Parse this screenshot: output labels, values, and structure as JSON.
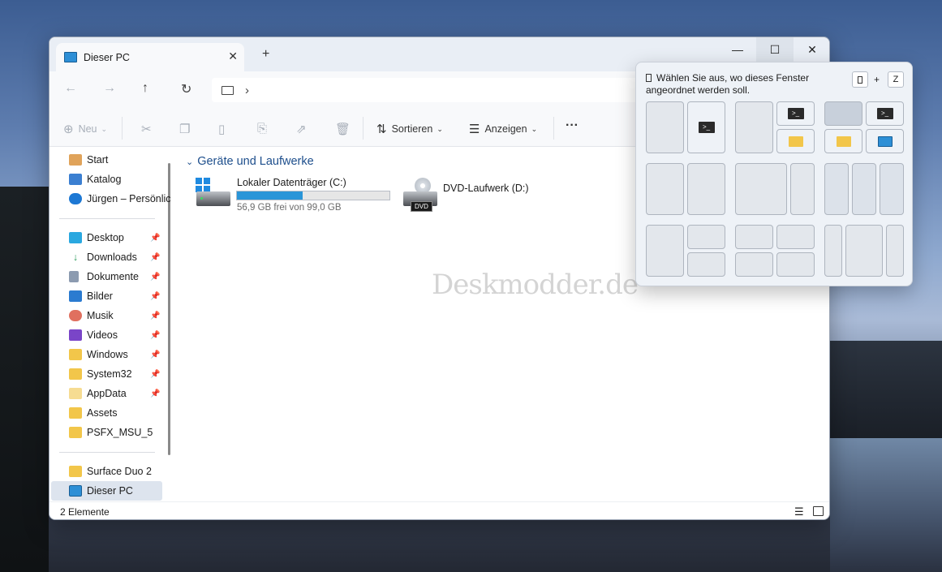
{
  "window": {
    "tab_title": "Dieser PC",
    "tab_close": "✕",
    "new_tab": "+",
    "minimize": "—",
    "maximize": "☐",
    "close": "✕"
  },
  "nav": {
    "back": "←",
    "forward": "→",
    "up": "↑",
    "refresh": "↻",
    "breadcrumb_sep": "›"
  },
  "toolbar": {
    "new_label": "Neu",
    "sort_label": "Sortieren",
    "view_label": "Anzeigen",
    "more_label": "···"
  },
  "sidebar": {
    "top_items": [
      {
        "label": "Start",
        "icon": "home-icon"
      },
      {
        "label": "Katalog",
        "icon": "gallery-icon"
      },
      {
        "label": "Jürgen – Persönlic",
        "icon": "onedrive-icon"
      }
    ],
    "pinned_items": [
      {
        "label": "Desktop",
        "icon": "desktop-icon"
      },
      {
        "label": "Downloads",
        "icon": "download-icon"
      },
      {
        "label": "Dokumente",
        "icon": "document-icon"
      },
      {
        "label": "Bilder",
        "icon": "pictures-icon"
      },
      {
        "label": "Musik",
        "icon": "music-icon"
      },
      {
        "label": "Videos",
        "icon": "video-icon"
      },
      {
        "label": "Windows",
        "icon": "folder-icon"
      },
      {
        "label": "System32",
        "icon": "folder-icon"
      },
      {
        "label": "AppData",
        "icon": "folder-icon"
      },
      {
        "label": "Assets",
        "icon": "folder-icon"
      },
      {
        "label": "PSFX_MSU_5",
        "icon": "folder-icon"
      }
    ],
    "bottom_items": [
      {
        "label": "Surface Duo 2",
        "icon": "folder-icon"
      },
      {
        "label": "Dieser PC",
        "icon": "pc-icon"
      }
    ]
  },
  "content": {
    "group_title": "Geräte und Laufwerke",
    "drives": [
      {
        "name": "Lokaler Datenträger (C:)",
        "free": "56,9 GB frei von 99,0 GB",
        "used_fraction": 0.43
      },
      {
        "name": "DVD-Laufwerk (D:)",
        "badge": "DVD"
      }
    ],
    "watermark": "Deskmodder.de"
  },
  "status": {
    "count": "2 Elemente"
  },
  "snap": {
    "hint": "Wählen Sie aus, wo dieses Fenster angeordnet werden soll.",
    "key_plus": "+",
    "key_z": "Z"
  },
  "colors": {
    "accent": "#2a95d8",
    "folder": "#f2c64a"
  }
}
